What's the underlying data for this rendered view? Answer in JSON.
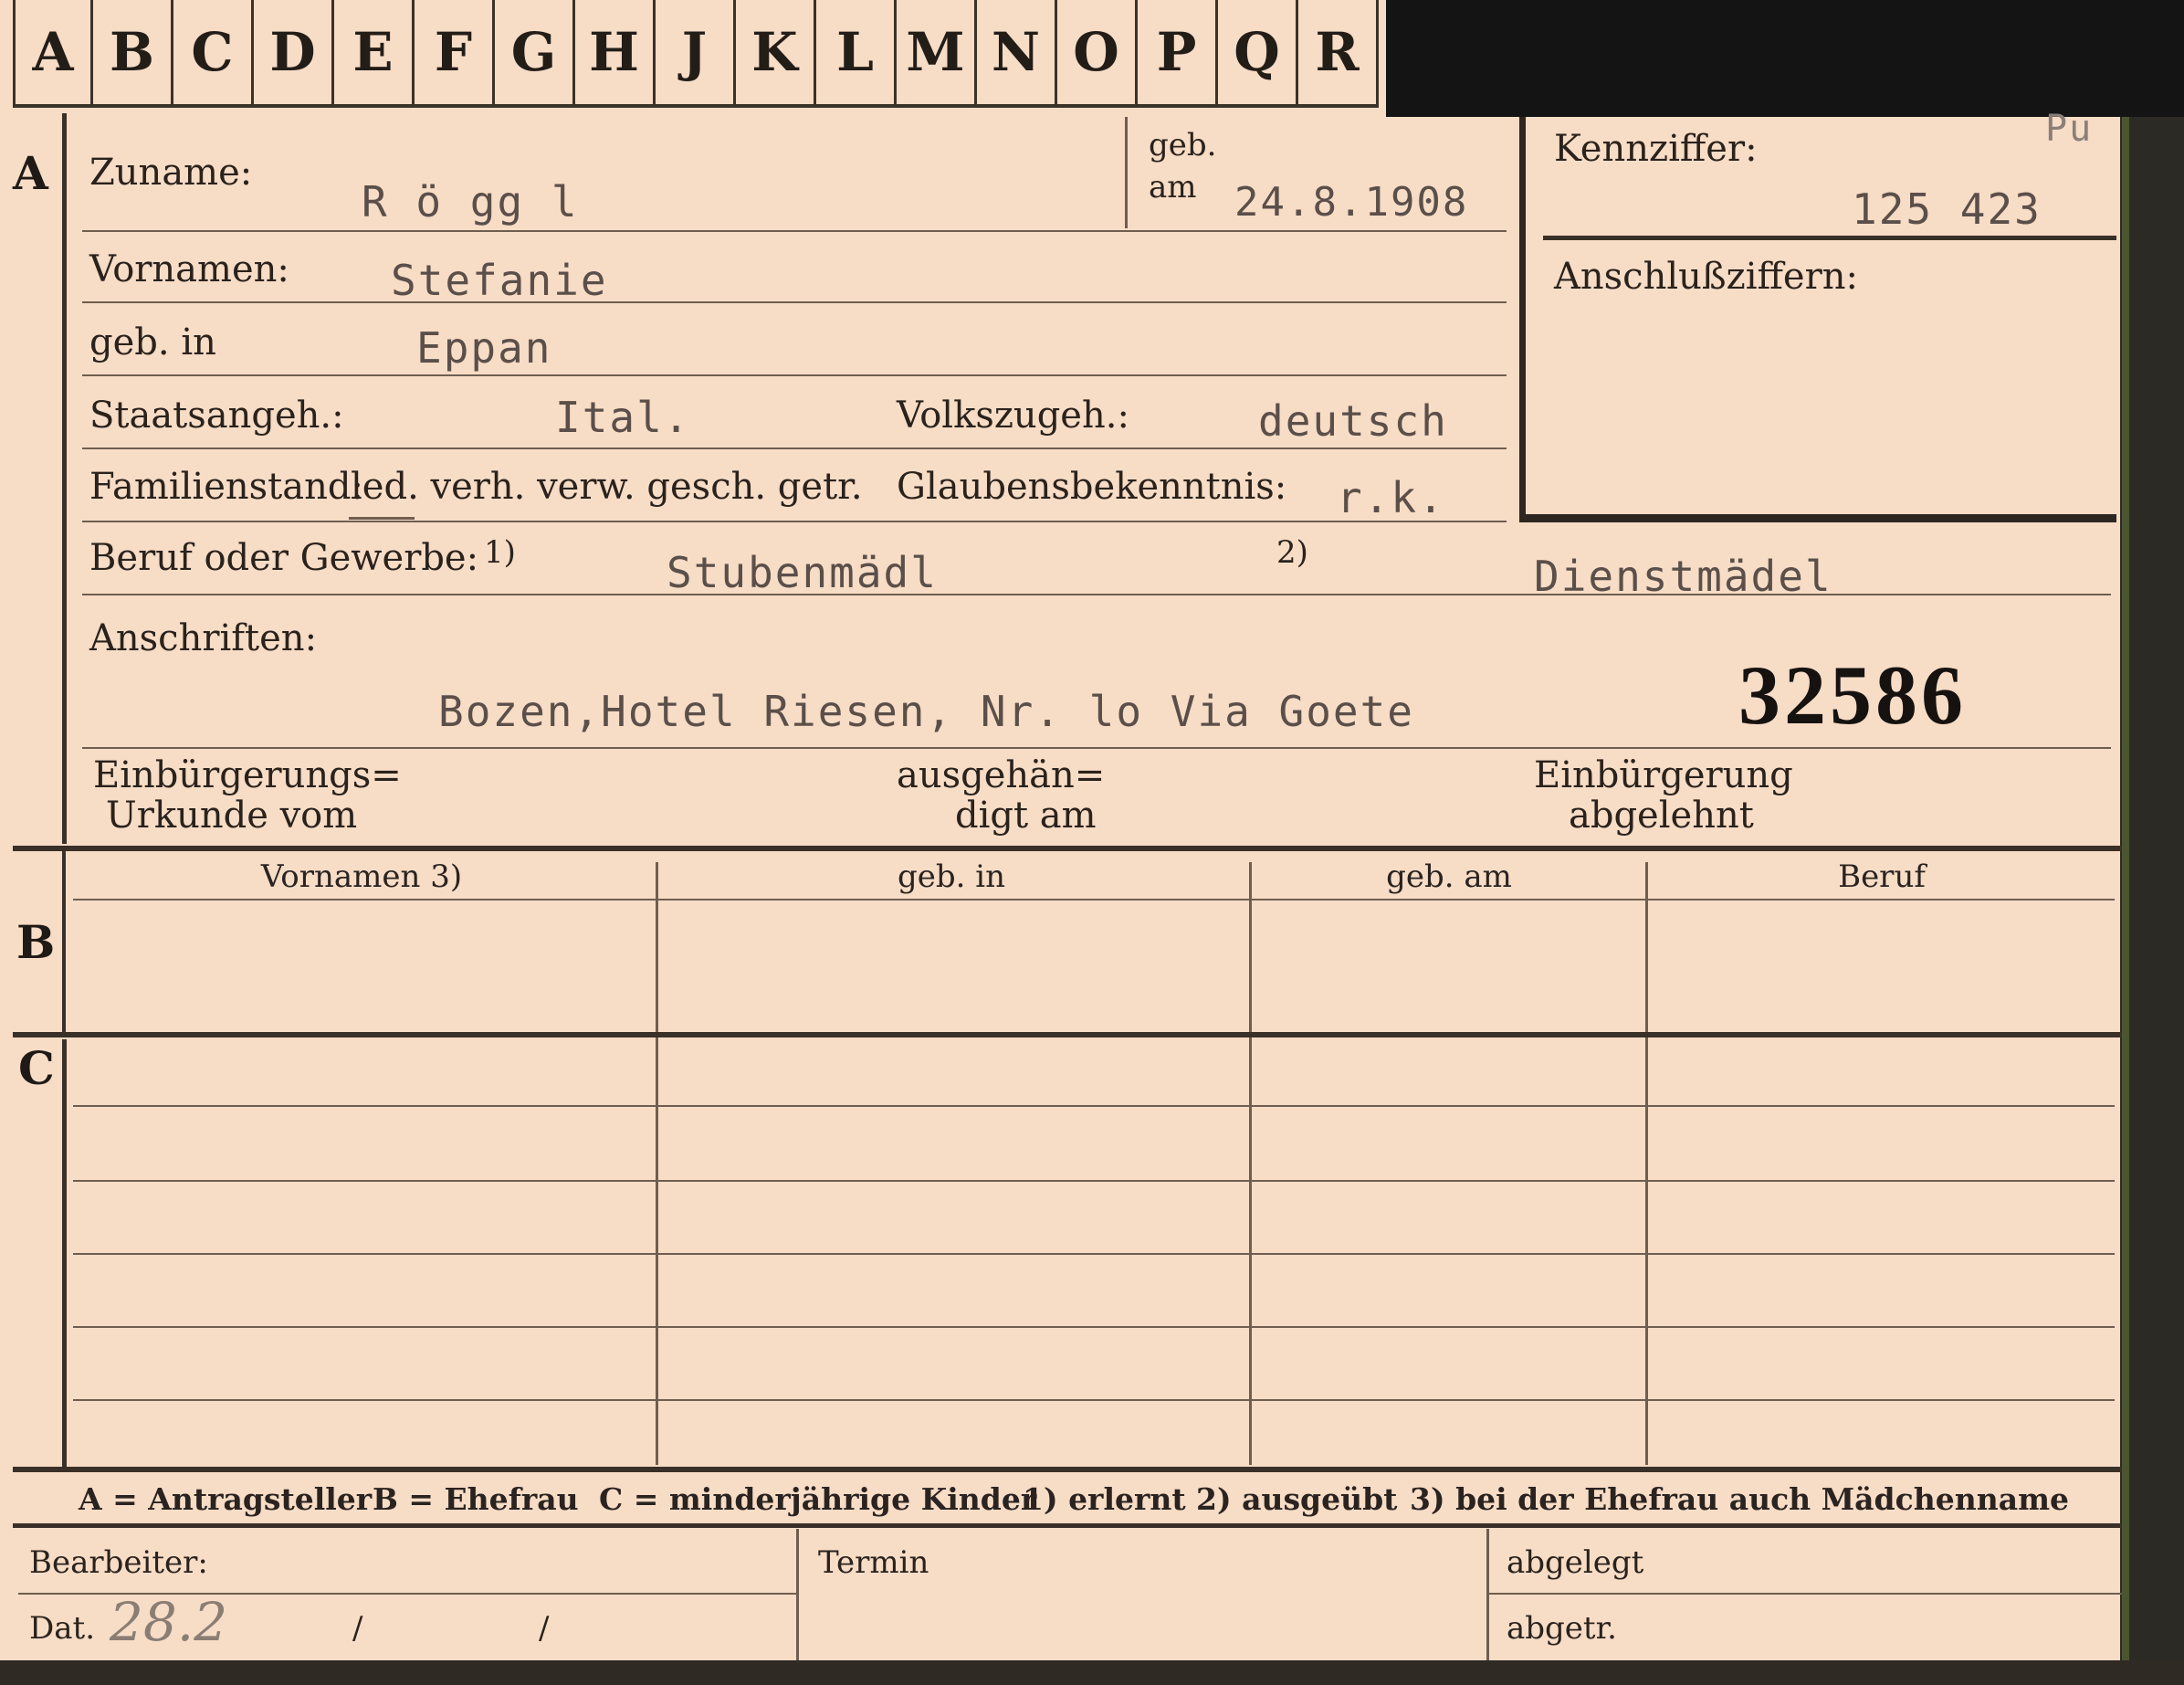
{
  "alphabet_tabs": [
    "A",
    "B",
    "C",
    "D",
    "E",
    "F",
    "G",
    "H",
    "J",
    "K",
    "L",
    "M",
    "N",
    "O",
    "P",
    "Q",
    "R"
  ],
  "sections": {
    "a": "A",
    "b": "B",
    "c": "C"
  },
  "fields": {
    "zuname_label": "Zuname:",
    "zuname_value": "R ö gg l",
    "geb_label": "geb.",
    "am_label": "am",
    "geb_am_value": "24.8.1908",
    "kennziffer_label": "Kennziffer:",
    "kennziffer_value": "125 423",
    "kennziffer_mark": "Pu",
    "anschluss_label": "Anschlußziffern:",
    "vornamen_label": "Vornamen:",
    "vornamen_value": "Stefanie",
    "geb_in_label": "geb. in",
    "geb_in_value": "Eppan",
    "staatsangeh_label": "Staatsangeh.:",
    "staatsangeh_value": "Ital.",
    "volkszugeh_label": "Volkszugeh.:",
    "volkszugeh_value": "deutsch",
    "familienstand_label": "Familienstand:",
    "familienstand_options": "led. verh. verw. gesch. getr.",
    "glaubens_label": "Glaubensbekenntnis:",
    "glaubens_value": "r.k.",
    "beruf_label": "Beruf oder Gewerbe:",
    "beruf_note1": "1)",
    "beruf_value1": "Stubenmädl",
    "beruf_note2": "2)",
    "beruf_value2": "Dienstmädel",
    "anschriften_label": "Anschriften:",
    "anschriften_value": "Bozen,Hotel Riesen, Nr. lo Via Goete",
    "stamp_number": "32586",
    "einbuergerung_urkunde_line1": "Einbürgerungs=",
    "einbuergerung_urkunde_line2": "Urkunde vom",
    "ausgehaendigt_line1": "ausgehän=",
    "ausgehaendigt_line2": "digt am",
    "einbuergerung_abgelehnt_line1": "Einbürgerung",
    "einbuergerung_abgelehnt_line2": "abgelehnt"
  },
  "table_headers": [
    "Vornamen 3)",
    "geb. in",
    "geb. am",
    "Beruf"
  ],
  "legend": {
    "a": "A = Antragsteller",
    "b": "B = Ehefrau",
    "c": "C = minderjährige Kinder",
    "n1": "1) erlernt",
    "n2": "2) ausgeübt",
    "n3": "3) bei der Ehefrau auch Mädchenname"
  },
  "footer": {
    "bearbeiter_label": "Bearbeiter:",
    "termin_label": "Termin",
    "abgelegt_label": "abgelegt",
    "dat_label": "Dat.",
    "dat_value": "28.2",
    "slash": "/",
    "abgetr_label": "abgetr."
  }
}
